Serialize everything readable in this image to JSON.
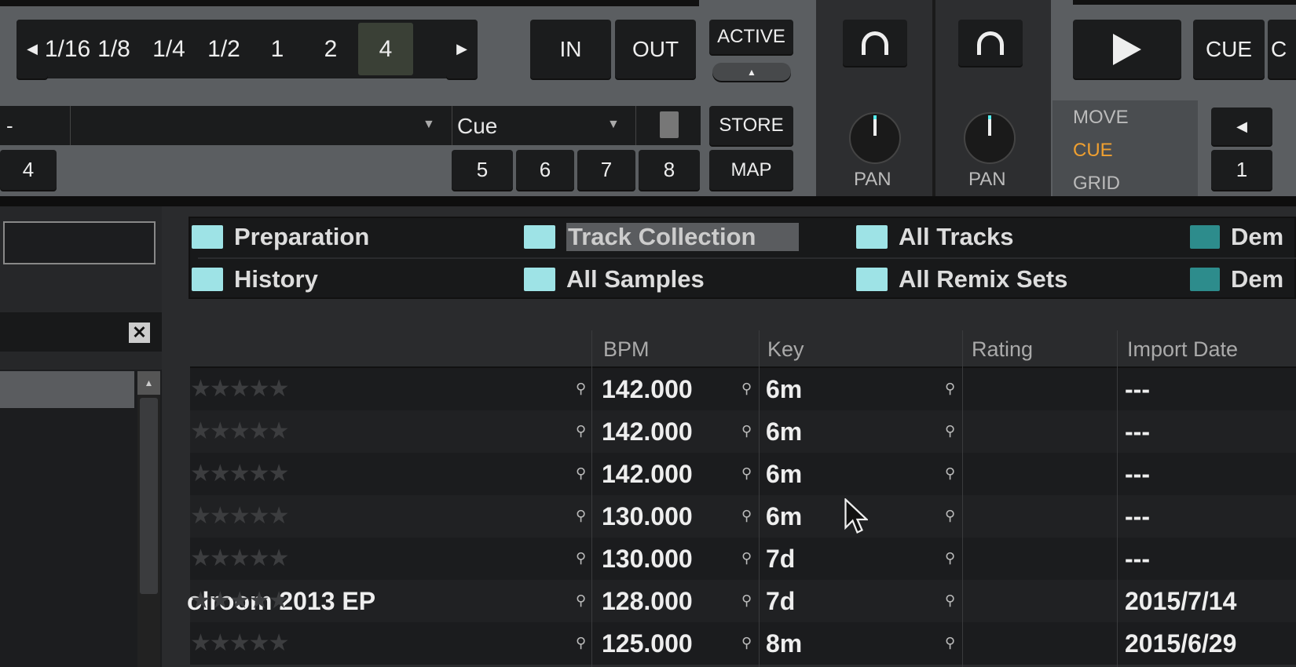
{
  "deck_a": {
    "loop_sizes": [
      "1/16",
      "1/8",
      "1/4",
      "1/2",
      "1",
      "2",
      "4"
    ],
    "selected_loop": "4",
    "in_label": "IN",
    "out_label": "OUT",
    "active_label": "ACTIVE",
    "cue_type": "Cue",
    "store_label": "STORE",
    "map_label": "MAP",
    "hotcues": [
      "4",
      "5",
      "6",
      "7",
      "8"
    ],
    "name_field": "-"
  },
  "mixer": {
    "pan_label": "PAN"
  },
  "deck_b": {
    "cue_label": "CUE",
    "partial_label": "C",
    "modes": [
      "MOVE",
      "CUE",
      "GRID"
    ],
    "active_mode": "CUE",
    "hotcue_1": "1"
  },
  "favorites": [
    {
      "label": "Preparation",
      "icon": "preparation-icon"
    },
    {
      "label": "Track Collection",
      "icon": "collection-icon",
      "selected": true
    },
    {
      "label": "All Tracks",
      "icon": "folder-icon"
    },
    {
      "label": "Dem",
      "icon": "play-folder-icon"
    },
    {
      "label": "History",
      "icon": "history-icon"
    },
    {
      "label": "All Samples",
      "icon": "folder-icon"
    },
    {
      "label": "All Remix Sets",
      "icon": "remix-icon"
    },
    {
      "label": "Dem",
      "icon": "play-folder-icon"
    }
  ],
  "table": {
    "headers": {
      "bpm": "BPM",
      "key": "Key",
      "rating": "Rating",
      "import_date": "Import Date"
    },
    "rows": [
      {
        "title": "",
        "bpm": "142.000",
        "key": "6m",
        "rating": 0,
        "import_date": "---"
      },
      {
        "title": "",
        "bpm": "142.000",
        "key": "6m",
        "rating": 0,
        "import_date": "---"
      },
      {
        "title": "",
        "bpm": "142.000",
        "key": "6m",
        "rating": 0,
        "import_date": "---"
      },
      {
        "title": "",
        "bpm": "130.000",
        "key": "6m",
        "rating": 0,
        "import_date": "---"
      },
      {
        "title": "",
        "bpm": "130.000",
        "key": "7d",
        "rating": 0,
        "import_date": "---"
      },
      {
        "title": "olroom 2013 EP",
        "bpm": "128.000",
        "key": "7d",
        "rating": 0,
        "import_date": "2015/7/14"
      },
      {
        "title": "",
        "bpm": "125.000",
        "key": "8m",
        "rating": 0,
        "import_date": "2015/6/29"
      }
    ]
  },
  "colors": {
    "accent": "#f0a030",
    "teal": "#9ee3e6",
    "deck_bg": "#5b5e61"
  }
}
